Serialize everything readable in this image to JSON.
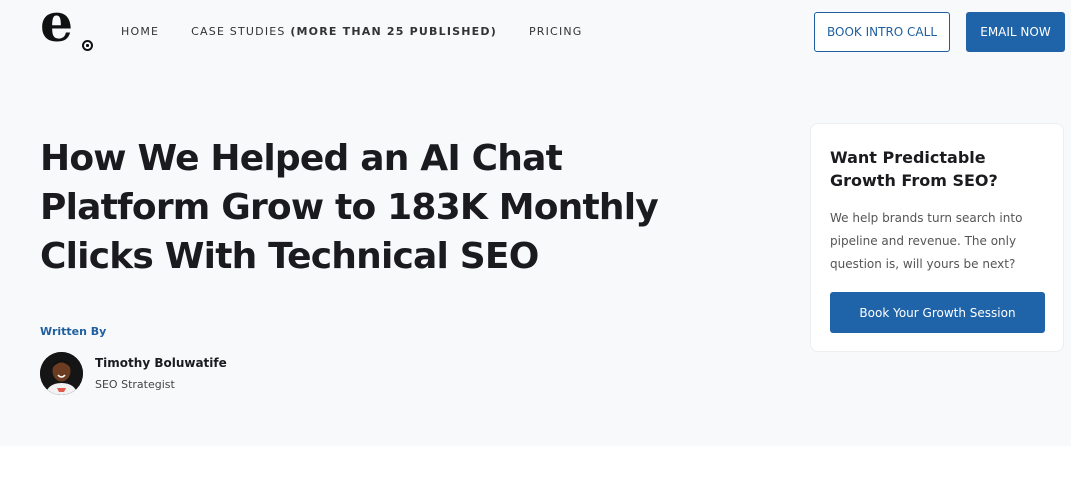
{
  "brand": {
    "logo_letter": "e"
  },
  "nav": {
    "home": "HOME",
    "case_studies": "CASE STUDIES",
    "case_studies_note": "(MORE THAN 25 PUBLISHED)",
    "pricing": "PRICING"
  },
  "header": {
    "book_intro_label": "BOOK INTRO CALL",
    "email_now_label": "EMAIL NOW"
  },
  "article": {
    "title": "How We Helped an AI Chat Platform Grow to 183K Monthly Clicks With Technical SEO",
    "written_by_label": "Written By",
    "author_name": "Timothy Boluwatife",
    "author_role": "SEO Strategist"
  },
  "cta_card": {
    "title": "Want Predictable Growth From SEO?",
    "text": "We help brands turn search into pipeline and revenue. The only question is, will yours be next?",
    "button_label": "Book Your Growth Session"
  },
  "colors": {
    "accent": "#1f63a8",
    "hero_background": "#f7f9fb"
  }
}
